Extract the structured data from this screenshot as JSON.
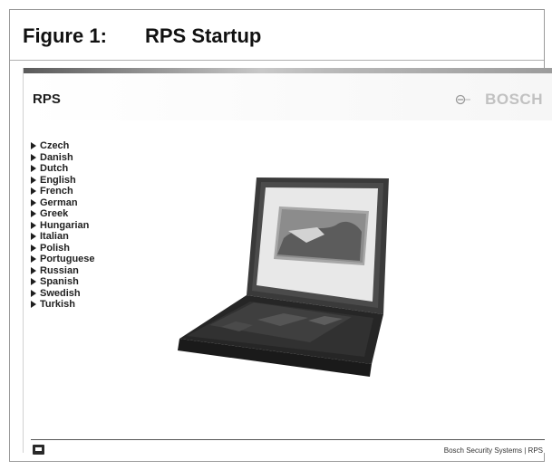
{
  "figure": {
    "label": "Figure 1:",
    "title": "RPS Startup"
  },
  "app": {
    "title": "RPS",
    "brand": "BOSCH"
  },
  "languages": [
    "Czech",
    "Danish",
    "Dutch",
    "English",
    "French",
    "German",
    "Greek",
    "Hungarian",
    "Italian",
    "Polish",
    "Portuguese",
    "Russian",
    "Spanish",
    "Swedish",
    "Turkish"
  ],
  "footer": {
    "text": "Bosch Security Systems | RPS"
  },
  "icons": {
    "language_arrow": "triangle-right-icon",
    "brand": "bosch-logo-icon",
    "footer": "chat-icon"
  },
  "colors": {
    "header_text": "#1e1e1e",
    "brand_text": "#c1c1c1",
    "footer_line": "#555555"
  }
}
